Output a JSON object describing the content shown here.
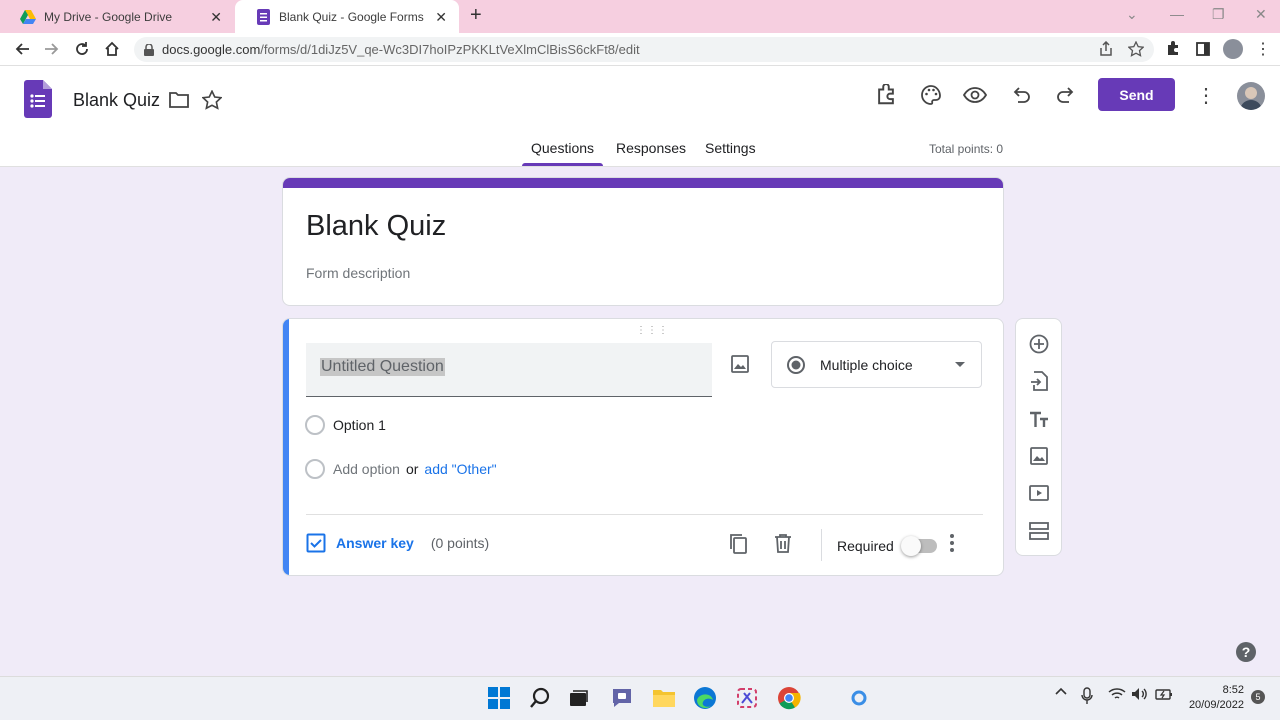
{
  "browser": {
    "tabs": [
      {
        "title": "My Drive - Google Drive",
        "active": false
      },
      {
        "title": "Blank Quiz - Google Forms",
        "active": true
      }
    ],
    "url_host": "docs.google.com",
    "url_path": "/forms/d/1diJz5V_qe-Wc3DI7hoIPzPKKLtVeXlmClBisS6ckFt8/edit"
  },
  "header": {
    "form_title": "Blank Quiz",
    "send_label": "Send",
    "tabs": [
      "Questions",
      "Responses",
      "Settings"
    ],
    "active_tab": "Questions",
    "total_points": "Total points: 0"
  },
  "title_card": {
    "title": "Blank Quiz",
    "description_placeholder": "Form description"
  },
  "question": {
    "title": "Untitled Question",
    "type": "Multiple choice",
    "options": [
      "Option 1"
    ],
    "add_option": "Add option",
    "or": "or",
    "add_other": "add \"Other\"",
    "answer_key": "Answer key",
    "points": "(0 points)",
    "required_label": "Required",
    "required": false
  },
  "help": "?",
  "taskbar": {
    "time": "8:52",
    "date": "20/09/2022",
    "notifications": "5"
  },
  "colors": {
    "accent": "#673ab7",
    "question_active": "#4285f4",
    "link": "#1a73e8",
    "background": "#f0ebf8"
  }
}
